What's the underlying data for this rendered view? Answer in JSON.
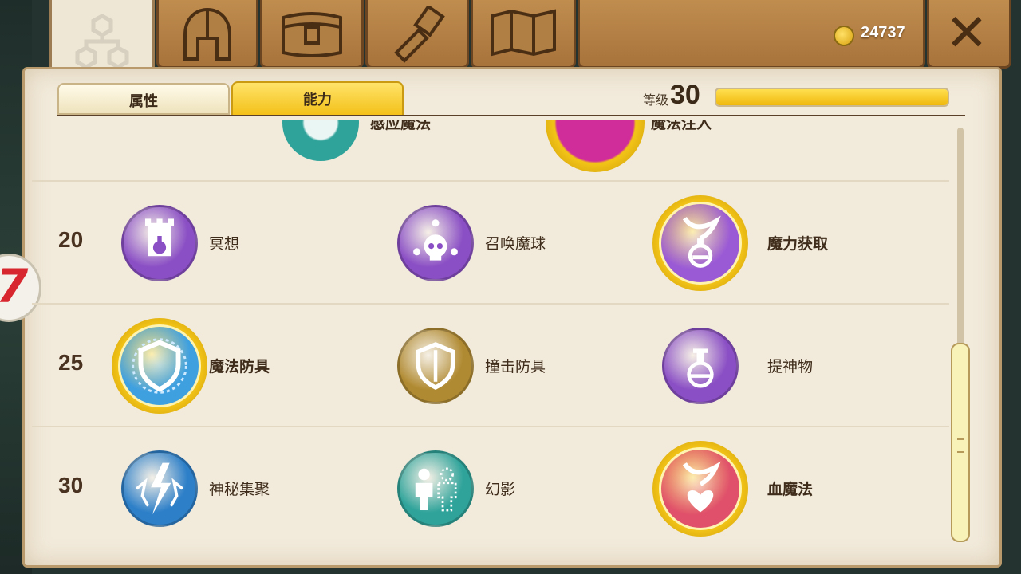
{
  "header": {
    "tabs": [
      {
        "id": "ability-tree",
        "icon": "skill-tree-icon",
        "active": true
      },
      {
        "id": "equipment",
        "icon": "helmet-icon",
        "active": false
      },
      {
        "id": "inventory",
        "icon": "chest-icon",
        "active": false
      },
      {
        "id": "crafting",
        "icon": "hammer-icon",
        "active": false
      },
      {
        "id": "map",
        "icon": "map-icon",
        "active": false
      }
    ],
    "coins": "24737",
    "close_label": "✕"
  },
  "subtabs": {
    "attributes": "属性",
    "abilities": "能力"
  },
  "level": {
    "label": "等级",
    "value": "30",
    "progress": 1.0
  },
  "rows": [
    {
      "level": "20",
      "skills": [
        {
          "name": "冥想",
          "icon": "tower-potion-icon",
          "color": "#8a4fc4",
          "learned": false
        },
        {
          "name": "召唤魔球",
          "icon": "skull-orbs-icon",
          "color": "#8a4fc4",
          "learned": false
        },
        {
          "name": "魔力获取",
          "icon": "hand-potion-icon",
          "color": "#9a5ad6",
          "learned": true
        }
      ]
    },
    {
      "level": "25",
      "skills": [
        {
          "name": "魔法防具",
          "icon": "magic-shield-icon",
          "color": "#3fa0e0",
          "learned": true
        },
        {
          "name": "撞击防具",
          "icon": "shield-icon",
          "color": "#b08a32",
          "learned": false
        },
        {
          "name": "提神物",
          "icon": "potion-icon",
          "color": "#8a4fc4",
          "learned": false
        }
      ]
    },
    {
      "level": "30",
      "skills": [
        {
          "name": "神秘集聚",
          "icon": "lightning-icon",
          "color": "#2d7fc8",
          "learned": false
        },
        {
          "name": "幻影",
          "icon": "phantom-icon",
          "color": "#2fa39a",
          "learned": false
        },
        {
          "name": "血魔法",
          "icon": "hand-heart-icon",
          "color": "#e0506a",
          "learned": true
        }
      ]
    }
  ],
  "partial_row": {
    "skills": [
      {
        "name": "感应魔法",
        "icon": "teal-orb-icon",
        "color": "#2fa39a",
        "learned": false
      },
      {
        "name": "魔法注入",
        "icon": "pink-orb-icon",
        "color": "#d02d9a",
        "learned": true
      }
    ]
  },
  "badge": "7"
}
